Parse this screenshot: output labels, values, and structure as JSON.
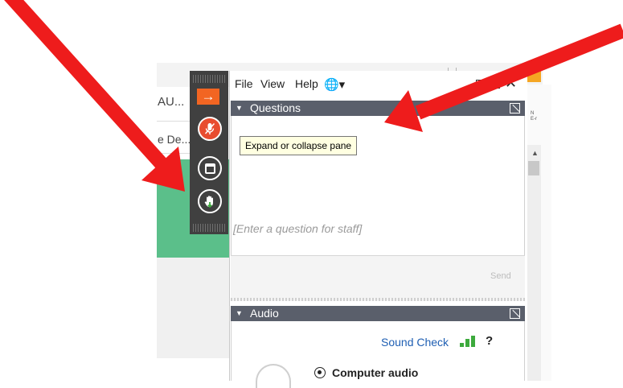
{
  "background_app": {
    "truncated_text_1": "AU...",
    "truncated_text_2": "e De...",
    "right_panel_text": "N\nE-r"
  },
  "toolbar": {
    "arrow_glyph": "→"
  },
  "menu": {
    "file": "File",
    "view": "View",
    "help": "Help",
    "globe": "🌐▾"
  },
  "window_controls": {
    "close": "✕"
  },
  "questions_pane": {
    "title": "Questions",
    "tooltip": "Expand or collapse pane",
    "input_placeholder": "[Enter a question for staff]",
    "send_label": "Send"
  },
  "audio_pane": {
    "title": "Audio",
    "sound_check_label": "Sound Check",
    "help_label": "?",
    "computer_audio_label": "Computer audio"
  },
  "colors": {
    "arrow_red": "#ee1c1c",
    "pane_header": "#5a5f6b",
    "strip": "#404040",
    "accent_orange": "#f26522",
    "link_blue": "#1f5fb3",
    "signal_green": "#3daa3d"
  }
}
